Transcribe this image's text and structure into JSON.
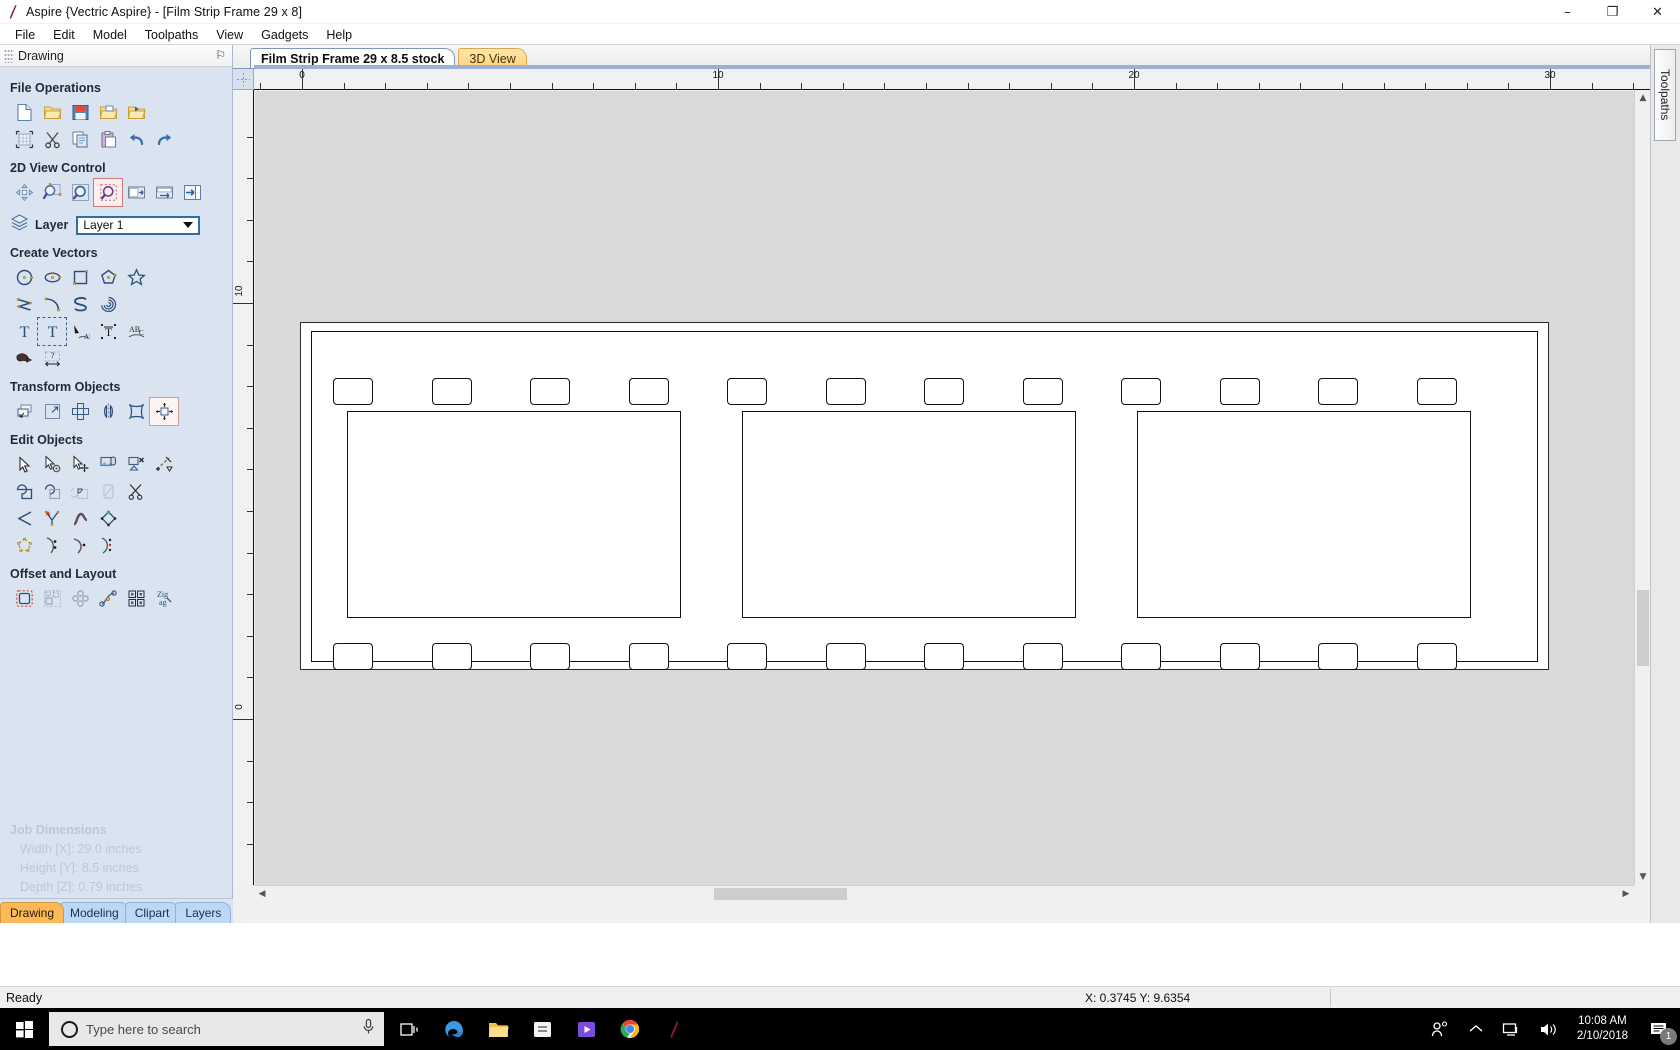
{
  "window": {
    "title": "Aspire {Vectric Aspire} - [Film Strip Frame 29 x 8]",
    "minimize": "–",
    "maximize": "❐",
    "close": "✕"
  },
  "menubar": {
    "items": [
      {
        "label": "File"
      },
      {
        "label": "Edit"
      },
      {
        "label": "Model"
      },
      {
        "label": "Toolpaths"
      },
      {
        "label": "View"
      },
      {
        "label": "Gadgets"
      },
      {
        "label": "Help"
      }
    ]
  },
  "left_panel": {
    "caption": "Drawing",
    "pin": "⚐",
    "groups": [
      {
        "title": "File Operations",
        "tools": [
          {
            "name": "new-file-icon"
          },
          {
            "name": "open-file-icon"
          },
          {
            "name": "save-file-icon"
          },
          {
            "name": "import-vectors-icon"
          },
          {
            "name": "import-bitmap-icon"
          },
          {
            "name": "set-job-size-icon"
          },
          {
            "name": "cut-icon"
          },
          {
            "name": "copy-icon"
          },
          {
            "name": "paste-icon"
          },
          {
            "name": "undo-icon"
          },
          {
            "name": "redo-icon"
          }
        ]
      },
      {
        "title": "2D View Control",
        "tools": [
          {
            "name": "pan-view-icon"
          },
          {
            "name": "zoom-window-icon"
          },
          {
            "name": "zoom-extents-icon"
          },
          {
            "name": "zoom-selected-icon"
          },
          {
            "name": "toggle-bitmap-icon"
          },
          {
            "name": "toggle-toolpath-preview-icon"
          },
          {
            "name": "toggle-3d-view-icon"
          }
        ]
      },
      {
        "title": "Create Vectors",
        "tools": [
          {
            "name": "draw-circle-icon"
          },
          {
            "name": "draw-ellipse-icon"
          },
          {
            "name": "draw-rectangle-icon"
          },
          {
            "name": "draw-polygon-icon"
          },
          {
            "name": "draw-star-icon"
          },
          {
            "name": "draw-polyline-icon"
          },
          {
            "name": "draw-arc-icon"
          },
          {
            "name": "draw-curve-icon"
          },
          {
            "name": "draw-spiral-icon"
          },
          {
            "name": "create-text-icon"
          },
          {
            "name": "edit-text-icon"
          },
          {
            "name": "text-on-curve-icon"
          },
          {
            "name": "auto-text-layout-icon"
          },
          {
            "name": "wrap-text-icon"
          },
          {
            "name": "trace-bitmap-icon"
          },
          {
            "name": "dimension-tool-icon"
          }
        ]
      },
      {
        "title": "Transform Objects",
        "tools": [
          {
            "name": "move-objects-icon"
          },
          {
            "name": "scale-objects-icon"
          },
          {
            "name": "rotate-objects-icon"
          },
          {
            "name": "mirror-objects-icon"
          },
          {
            "name": "distort-objects-icon"
          },
          {
            "name": "align-objects-icon"
          }
        ]
      },
      {
        "title": "Edit Objects",
        "tools": [
          {
            "name": "select-tool-icon"
          },
          {
            "name": "node-edit-icon"
          },
          {
            "name": "move-node-icon"
          },
          {
            "name": "group-vectors-icon"
          },
          {
            "name": "ungroup-vectors-icon"
          },
          {
            "name": "join-vectors-icon"
          },
          {
            "name": "weld-vectors-icon"
          },
          {
            "name": "subtract-vectors-icon"
          },
          {
            "name": "intersect-vectors-icon"
          },
          {
            "name": "clip-vectors-icon"
          },
          {
            "name": "trim-vectors-icon"
          },
          {
            "name": "fillet-corner-icon"
          },
          {
            "name": "insert-node-icon"
          },
          {
            "name": "smooth-curve-icon"
          },
          {
            "name": "close-vector-icon"
          },
          {
            "name": "polygon-node-icon"
          },
          {
            "name": "start-node-icon"
          },
          {
            "name": "arc-node-icon"
          },
          {
            "name": "bezier-node-icon"
          }
        ]
      },
      {
        "title": "Offset and Layout",
        "tools": [
          {
            "name": "offset-vectors-icon"
          },
          {
            "name": "nesting-icon"
          },
          {
            "name": "array-copy-icon"
          },
          {
            "name": "copy-along-curve-icon"
          },
          {
            "name": "block-copy-icon"
          },
          {
            "name": "zigzag-layout-icon"
          }
        ]
      }
    ],
    "layer": {
      "label": "Layer",
      "selected": "Layer 1",
      "icon": "layers-icon"
    },
    "job_dimensions": {
      "title": "Job Dimensions",
      "lines": [
        "Width  [X]: 29.0 inches",
        "Height [Y]: 8.5 inches",
        "Depth  [Z]: 0.79 inches"
      ]
    },
    "tabs": [
      {
        "label": "Drawing",
        "active": true
      },
      {
        "label": "Modeling",
        "active": false
      },
      {
        "label": "Clipart",
        "active": false
      },
      {
        "label": "Layers",
        "active": false
      }
    ]
  },
  "document": {
    "tabs": [
      {
        "label": "Film Strip Frame 29 x 8.5 stock",
        "active": true
      },
      {
        "label": "3D View",
        "active": false
      }
    ],
    "ruler_h": {
      "labels": [
        "0",
        "10",
        "20"
      ],
      "unit": "inches"
    },
    "ruler_v": {
      "labels": [
        "10",
        "0"
      ]
    }
  },
  "right_panel": {
    "tab_label": "Toolpaths"
  },
  "statusbar": {
    "ready": "Ready",
    "coords": "X:  0.3745 Y:  9.6354"
  },
  "taskbar": {
    "start": "start-button",
    "search_placeholder": "Type here to search",
    "mic": "microphone-icon",
    "apps": [
      {
        "name": "task-view-icon"
      },
      {
        "name": "edge-browser-icon"
      },
      {
        "name": "file-explorer-icon"
      },
      {
        "name": "store-icon"
      },
      {
        "name": "media-player-icon"
      },
      {
        "name": "chrome-browser-icon"
      },
      {
        "name": "aspire-app-icon"
      }
    ],
    "tray": [
      {
        "name": "people-icon"
      },
      {
        "name": "show-hidden-icons-icon"
      },
      {
        "name": "network-icon"
      },
      {
        "name": "volume-icon"
      }
    ],
    "time": "10:08 AM",
    "date": "2/10/2018",
    "notification_count": "1"
  },
  "drawing": {
    "name": "film-strip-frame",
    "sprocket_count_per_row": 12,
    "frame_count": 3,
    "rows": [
      "top-sprockets",
      "bottom-sprockets"
    ]
  },
  "colors": {
    "panel_bg": "#d9e4f0",
    "accent_tab": "#fbb957",
    "canvas_bg": "#d9d9d9",
    "material": "#ffffff",
    "combo_border": "#2c6ea5"
  }
}
